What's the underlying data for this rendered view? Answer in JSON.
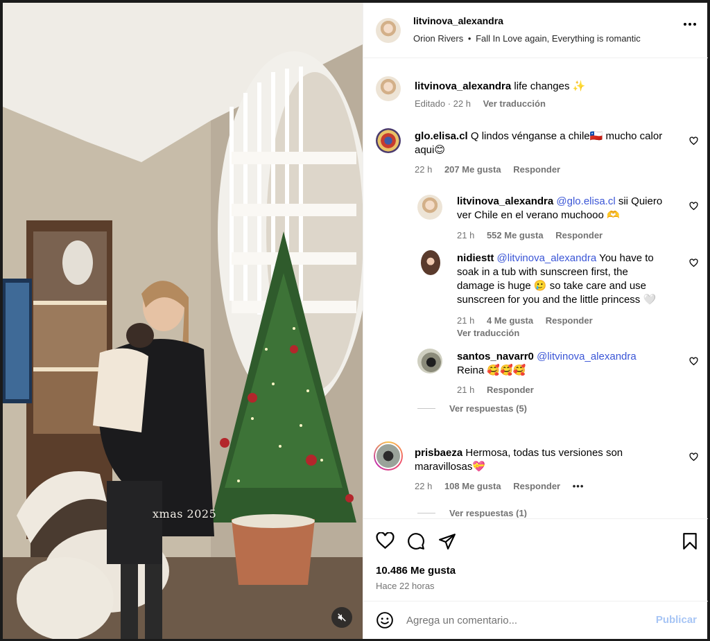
{
  "post": {
    "media": {
      "overlay_text": "xmas 2025"
    },
    "header": {
      "username": "litvinova_alexandra",
      "audio_artist": "Orion Rivers",
      "audio_separator": "•",
      "audio_track": "Fall In Love again, Everything is romantic"
    },
    "caption": {
      "username": "litvinova_alexandra",
      "text": "life changes ✨",
      "edited": "Editado · 22 h",
      "translate": "Ver traducción"
    },
    "comments": [
      {
        "username": "glo.elisa.cl",
        "text_1": "Q lindos vénganse a chile🇨🇱 mucho calor",
        "text_2": "aqui😊",
        "time": "22 h",
        "likes": "207 Me gusta",
        "reply": "Responder"
      },
      {
        "username": "litvinova_alexandra",
        "mention": "@glo.elisa.cl",
        "text_1": "sii Quiero",
        "text_2": "ver Chile en el verano muchooo 🫶",
        "time": "21 h",
        "likes": "552 Me gusta",
        "reply": "Responder"
      },
      {
        "username": "nidiestt",
        "mention": "@litvinova_alexandra",
        "text_1": "You have to",
        "text_2": "soak in a tub with sunscreen first, the",
        "text_3": "damage is huge 🥲 so take care and use",
        "text_4": "sunscreen for you and the little princess 🤍",
        "time": "21 h",
        "likes": "4 Me gusta",
        "reply": "Responder",
        "translate": "Ver traducción"
      },
      {
        "username": "santos_navarr0",
        "mention": "@litvinova_alexandra",
        "text_2": "Reina 🥰🥰🥰",
        "time": "21 h",
        "reply": "Responder"
      },
      {
        "username": "prisbaeza",
        "text_1": "Hermosa, todas tus versiones son",
        "text_2": "maravillosas💝",
        "time": "22 h",
        "likes": "108 Me gusta",
        "reply": "Responder",
        "more": "•••"
      }
    ],
    "view_replies_1": "Ver respuestas (5)",
    "view_replies_2": "Ver respuestas (1)",
    "likes_total": "10.486 Me gusta",
    "posted_ago": "Hace 22 horas",
    "composer": {
      "placeholder": "Agrega un comentario...",
      "publish": "Publicar"
    }
  },
  "colors": {
    "mention": "#3a55d6",
    "publish_disabled": "#a7c5f5",
    "meta_gray": "#737373"
  },
  "icons": [
    "more-options-icon",
    "heart-icon",
    "comment-icon",
    "share-icon",
    "bookmark-icon",
    "emoji-icon",
    "mute-icon"
  ]
}
